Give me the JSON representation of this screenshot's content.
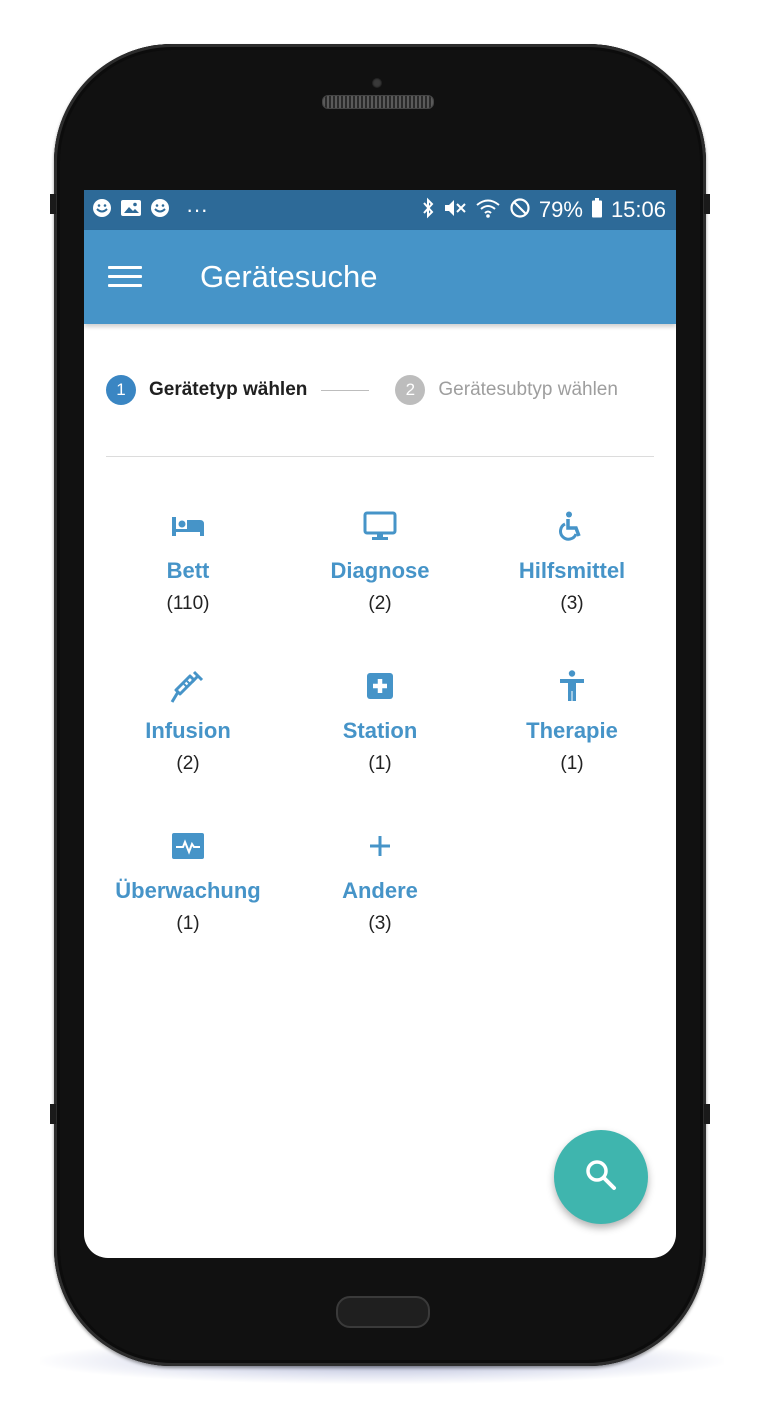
{
  "status_bar": {
    "more_dots": "···",
    "battery": "79%",
    "time": "15:06",
    "left_icons": [
      "face-icon",
      "image-icon",
      "face-icon"
    ],
    "right_icons": [
      "bluetooth-icon",
      "mute-icon",
      "wifi-icon",
      "block-icon",
      "battery-icon"
    ]
  },
  "app_bar": {
    "title": "Gerätesuche",
    "menu_icon": "menu-icon"
  },
  "stepper": {
    "step1": {
      "number": "1",
      "label": "Gerätetyp wählen",
      "state": "active"
    },
    "step2": {
      "number": "2",
      "label": "Gerätesubtyp wählen",
      "state": "inactive"
    }
  },
  "categories": [
    {
      "name": "Bett",
      "count": "(110)",
      "icon": "bed-icon"
    },
    {
      "name": "Diagnose",
      "count": "(2)",
      "icon": "monitor-icon"
    },
    {
      "name": "Hilfsmittel",
      "count": "(3)",
      "icon": "wheelchair-icon"
    },
    {
      "name": "Infusion",
      "count": "(2)",
      "icon": "syringe-icon"
    },
    {
      "name": "Station",
      "count": "(1)",
      "icon": "medical-cross-icon"
    },
    {
      "name": "Therapie",
      "count": "(1)",
      "icon": "person-icon"
    },
    {
      "name": "Überwachung",
      "count": "(1)",
      "icon": "heartbeat-monitor-icon"
    },
    {
      "name": "Andere",
      "count": "(3)",
      "icon": "plus-icon"
    }
  ],
  "fab": {
    "icon": "search-icon"
  },
  "colors": {
    "status_bar": "#2d6a98",
    "app_bar": "#4694c8",
    "accent": "#4694c8",
    "step_active": "#3a86c3",
    "step_inactive": "#bdbdbd",
    "fab": "#3fb5ae"
  }
}
